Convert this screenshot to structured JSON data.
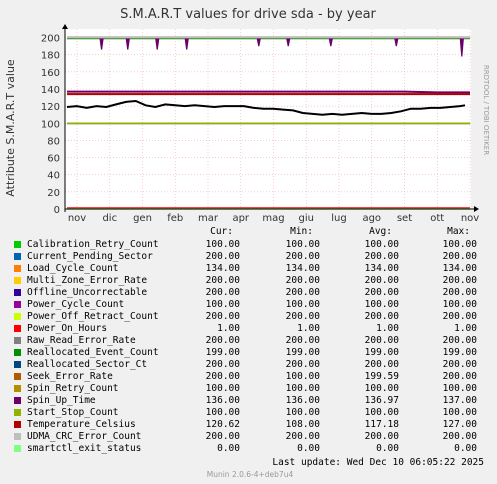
{
  "page": {
    "background": "#f0f0f0",
    "plot_background": "#ffffff"
  },
  "rrdtool_label": "RRDTOOL / TOBI OETIKER",
  "footer": "Munin 2.0.6-4+deb7u4",
  "last_update": "Last update:  Wed Dec 10 06:05:22 2025",
  "legend": {
    "headers": [
      "Cur:",
      "Min:",
      "Avg:",
      "Max:"
    ],
    "rows": [
      {
        "name": "Calibration_Retry_Count",
        "color": "#00cc00",
        "cur": "100.00",
        "min": "100.00",
        "avg": "100.00",
        "max": "100.00"
      },
      {
        "name": "Current_Pending_Sector",
        "color": "#0066b3",
        "cur": "200.00",
        "min": "200.00",
        "avg": "200.00",
        "max": "200.00"
      },
      {
        "name": "Load_Cycle_Count",
        "color": "#ff8000",
        "cur": "134.00",
        "min": "134.00",
        "avg": "134.00",
        "max": "134.00"
      },
      {
        "name": "Multi_Zone_Error_Rate",
        "color": "#ffcc00",
        "cur": "200.00",
        "min": "200.00",
        "avg": "200.00",
        "max": "200.00"
      },
      {
        "name": "Offline_Uncorrectable",
        "color": "#330099",
        "cur": "200.00",
        "min": "200.00",
        "avg": "200.00",
        "max": "200.00"
      },
      {
        "name": "Power_Cycle_Count",
        "color": "#990099",
        "cur": "100.00",
        "min": "100.00",
        "avg": "100.00",
        "max": "100.00"
      },
      {
        "name": "Power_Off_Retract_Count",
        "color": "#ccff00",
        "cur": "200.00",
        "min": "200.00",
        "avg": "200.00",
        "max": "200.00"
      },
      {
        "name": "Power_On_Hours",
        "color": "#ff0000",
        "cur": "1.00",
        "min": "1.00",
        "avg": "1.00",
        "max": "1.00"
      },
      {
        "name": "Raw_Read_Error_Rate",
        "color": "#808080",
        "cur": "200.00",
        "min": "200.00",
        "avg": "200.00",
        "max": "200.00"
      },
      {
        "name": "Reallocated_Event_Count",
        "color": "#008f00",
        "cur": "199.00",
        "min": "199.00",
        "avg": "199.00",
        "max": "199.00"
      },
      {
        "name": "Reallocated_Sector_Ct",
        "color": "#00487d",
        "cur": "200.00",
        "min": "200.00",
        "avg": "200.00",
        "max": "200.00"
      },
      {
        "name": "Seek_Error_Rate",
        "color": "#b35a00",
        "cur": "200.00",
        "min": "100.00",
        "avg": "199.59",
        "max": "200.00"
      },
      {
        "name": "Spin_Retry_Count",
        "color": "#b38f00",
        "cur": "100.00",
        "min": "100.00",
        "avg": "100.00",
        "max": "100.00"
      },
      {
        "name": "Spin_Up_Time",
        "color": "#6b006b",
        "cur": "136.00",
        "min": "136.00",
        "avg": "136.97",
        "max": "137.00"
      },
      {
        "name": "Start_Stop_Count",
        "color": "#8fb300",
        "cur": "100.00",
        "min": "100.00",
        "avg": "100.00",
        "max": "100.00"
      },
      {
        "name": "Temperature_Celsius",
        "color": "#b30000",
        "cur": "120.62",
        "min": "108.00",
        "avg": "117.18",
        "max": "127.00"
      },
      {
        "name": "UDMA_CRC_Error_Count",
        "color": "#bebebe",
        "cur": "200.00",
        "min": "200.00",
        "avg": "200.00",
        "max": "200.00"
      },
      {
        "name": "smartctl_exit_status",
        "color": "#80ff80",
        "cur": "0.00",
        "min": "0.00",
        "avg": "0.00",
        "max": "0.00"
      }
    ]
  },
  "chart_data": {
    "type": "line",
    "title": "S.M.A.R.T values for drive sda - by year",
    "ylabel": "Attribute S.M.A.R.T value",
    "xlabel": "",
    "ylim": [
      0,
      210
    ],
    "yticks": [
      0,
      20,
      40,
      60,
      80,
      100,
      120,
      140,
      160,
      180,
      200
    ],
    "categories": [
      "nov",
      "dic",
      "gen",
      "feb",
      "mar",
      "apr",
      "mag",
      "giu",
      "lug",
      "ago",
      "set",
      "ott",
      "nov"
    ],
    "grid": true,
    "series": [
      {
        "name": "Calibration_Retry_Count",
        "color": "#00cc00",
        "values": [
          100,
          100,
          100,
          100,
          100,
          100,
          100,
          100,
          100,
          100,
          100,
          100,
          100
        ]
      },
      {
        "name": "Current_Pending_Sector",
        "color": "#0066b3",
        "values": [
          200,
          200,
          200,
          200,
          200,
          200,
          200,
          200,
          200,
          200,
          200,
          200,
          200
        ]
      },
      {
        "name": "Load_Cycle_Count",
        "color": "#ff8000",
        "values": [
          134,
          134,
          134,
          134,
          134,
          134,
          134,
          134,
          134,
          134,
          134,
          134,
          134
        ]
      },
      {
        "name": "Multi_Zone_Error_Rate",
        "color": "#ffcc00",
        "values": [
          200,
          200,
          200,
          200,
          200,
          200,
          200,
          200,
          200,
          200,
          200,
          200,
          200
        ]
      },
      {
        "name": "Offline_Uncorrectable",
        "color": "#330099",
        "values": [
          200,
          200,
          200,
          200,
          200,
          200,
          200,
          200,
          200,
          200,
          200,
          200,
          200
        ]
      },
      {
        "name": "Power_Cycle_Count",
        "color": "#990099",
        "values": [
          100,
          100,
          100,
          100,
          100,
          100,
          100,
          100,
          100,
          100,
          100,
          100,
          100
        ]
      },
      {
        "name": "Power_Off_Retract_Count",
        "color": "#ccff00",
        "values": [
          200,
          200,
          200,
          200,
          200,
          200,
          200,
          200,
          200,
          200,
          200,
          200,
          200
        ]
      },
      {
        "name": "Power_On_Hours",
        "color": "#ff0000",
        "values": [
          1,
          1,
          1,
          1,
          1,
          1,
          1,
          1,
          1,
          1,
          1,
          1,
          1
        ]
      },
      {
        "name": "Raw_Read_Error_Rate",
        "color": "#808080",
        "values": [
          200,
          200,
          200,
          200,
          200,
          200,
          200,
          200,
          200,
          200,
          200,
          200,
          200
        ]
      },
      {
        "name": "Reallocated_Event_Count",
        "color": "#008f00",
        "values": [
          199,
          199,
          199,
          199,
          199,
          199,
          199,
          199,
          199,
          199,
          199,
          199,
          199
        ]
      },
      {
        "name": "Reallocated_Sector_Ct",
        "color": "#00487d",
        "values": [
          200,
          200,
          200,
          200,
          200,
          200,
          200,
          200,
          200,
          200,
          200,
          200,
          200
        ]
      },
      {
        "name": "Seek_Error_Rate",
        "color": "#b35a00",
        "values": [
          200,
          200,
          200,
          200,
          200,
          200,
          200,
          200,
          200,
          200,
          200,
          200,
          200
        ]
      },
      {
        "name": "Spin_Retry_Count",
        "color": "#b38f00",
        "values": [
          100,
          100,
          100,
          100,
          100,
          100,
          100,
          100,
          100,
          100,
          100,
          100,
          100
        ]
      },
      {
        "name": "Spin_Up_Time",
        "color": "#6b006b",
        "values": [
          137,
          137,
          137,
          137,
          137,
          137,
          137,
          137,
          137,
          137,
          137,
          136,
          136
        ],
        "dips": [
          {
            "x": 0.75,
            "y": 186
          },
          {
            "x": 1.55,
            "y": 186
          },
          {
            "x": 2.45,
            "y": 186
          },
          {
            "x": 3.35,
            "y": 186
          },
          {
            "x": 5.55,
            "y": 190
          },
          {
            "x": 6.45,
            "y": 190
          },
          {
            "x": 7.75,
            "y": 190
          },
          {
            "x": 9.75,
            "y": 190
          },
          {
            "x": 11.75,
            "y": 178
          }
        ]
      },
      {
        "name": "Start_Stop_Count",
        "color": "#8fb300",
        "values": [
          100,
          100,
          100,
          100,
          100,
          100,
          100,
          100,
          100,
          100,
          100,
          100,
          100
        ]
      },
      {
        "name": "Temperature_Celsius",
        "color": "#b30000",
        "values": [
          134,
          134,
          134,
          134,
          134,
          134,
          134,
          134,
          134,
          134,
          134,
          134,
          134
        ]
      },
      {
        "name": "Temperature_Celsius",
        "color": "#000000",
        "x": [
          0,
          0.3,
          0.6,
          0.9,
          1.2,
          1.5,
          1.8,
          2.1,
          2.4,
          2.7,
          3.0,
          3.3,
          3.6,
          3.9,
          4.2,
          4.5,
          4.8,
          5.1,
          5.4,
          5.7,
          6.0,
          6.3,
          6.6,
          6.9,
          7.2,
          7.5,
          7.8,
          8.1,
          8.4,
          8.7,
          9.0,
          9.3,
          9.6,
          9.9,
          10.2,
          10.5,
          10.8,
          11.1,
          11.4,
          11.7,
          12.0,
          12.3
        ],
        "values": [
          119,
          120,
          118,
          120,
          119,
          122,
          125,
          126,
          121,
          119,
          122,
          121,
          120,
          121,
          120,
          119,
          120,
          120,
          120,
          118,
          117,
          117,
          116,
          115,
          112,
          111,
          110,
          111,
          110,
          111,
          112,
          111,
          111,
          112,
          114,
          117,
          117,
          118,
          118,
          119,
          120,
          121
        ]
      },
      {
        "name": "UDMA_CRC_Error_Count",
        "color": "#bebebe",
        "values": [
          200,
          200,
          200,
          200,
          200,
          200,
          200,
          200,
          200,
          200,
          200,
          200,
          200
        ]
      },
      {
        "name": "smartctl_exit_status",
        "color": "#80ff80",
        "values": [
          0,
          0,
          0,
          0,
          0,
          0,
          0,
          0,
          0,
          0,
          0,
          0,
          0
        ]
      }
    ]
  }
}
